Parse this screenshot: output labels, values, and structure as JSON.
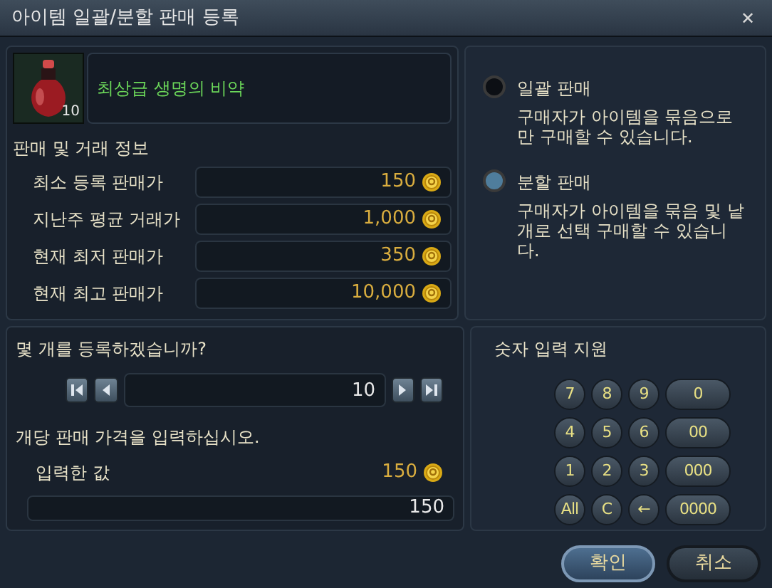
{
  "window": {
    "title": "아이템 일괄/분할 판매 등록",
    "close": "✕"
  },
  "item": {
    "name": "최상급 생명의 비약",
    "count": "10"
  },
  "trade_info": {
    "heading": "판매 및 거래 정보",
    "rows": [
      {
        "label": "최소 등록 판매가",
        "value": "150"
      },
      {
        "label": "지난주 평균 거래가",
        "value": "1,000"
      },
      {
        "label": "현재 최저 판매가",
        "value": "350"
      },
      {
        "label": "현재 최고 판매가",
        "value": "10,000"
      }
    ]
  },
  "sale_modes": [
    {
      "label": "일괄 판매",
      "description": "구매자가 아이템을 묶음으로 만 구매할 수 있습니다.",
      "selected": false
    },
    {
      "label": "분할 판매",
      "description": "구매자가 아이템을 묶음 및 낱개로 선택 구매할 수 있습니다.",
      "selected": true
    }
  ],
  "quantity": {
    "question": "몇 개를 등록하겠습니까?",
    "value": "10"
  },
  "price": {
    "prompt": "개당 판매 가격을 입력하십시오.",
    "label": "입력한 값",
    "display": "150",
    "value": "150"
  },
  "keypad": {
    "title": "숫자 입력 지원",
    "rows": [
      [
        "7",
        "8",
        "9",
        "0"
      ],
      [
        "4",
        "5",
        "6",
        "00"
      ],
      [
        "1",
        "2",
        "3",
        "000"
      ],
      [
        "All",
        "C",
        "←",
        "0000"
      ]
    ]
  },
  "buttons": [
    {
      "label": "확인",
      "selected": true
    },
    {
      "label": "취소",
      "selected": false
    }
  ]
}
